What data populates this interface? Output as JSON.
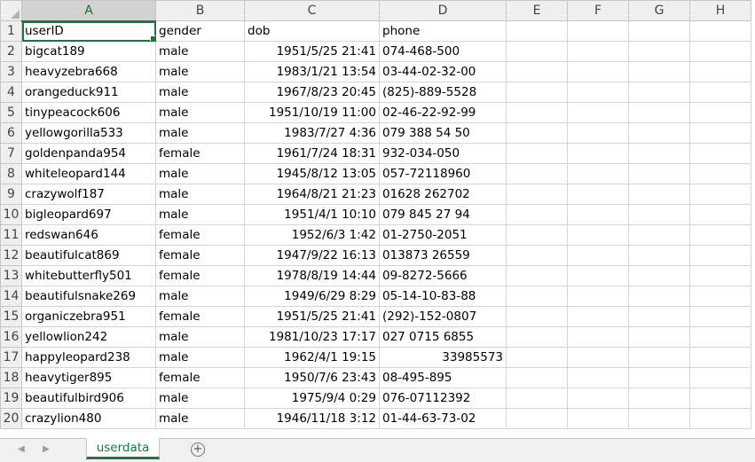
{
  "columns": [
    "A",
    "B",
    "C",
    "D",
    "E",
    "F",
    "G",
    "H"
  ],
  "rows": [
    {
      "n": "1",
      "a": "userID",
      "b": "gender",
      "c": "dob",
      "d": "phone",
      "d_num": false
    },
    {
      "n": "2",
      "a": "bigcat189",
      "b": "male",
      "c": "1951/5/25 21:41",
      "d": "074-468-500",
      "d_num": false
    },
    {
      "n": "3",
      "a": "heavyzebra668",
      "b": "male",
      "c": "1983/1/21 13:54",
      "d": "03-44-02-32-00",
      "d_num": false
    },
    {
      "n": "4",
      "a": "orangeduck911",
      "b": "male",
      "c": "1967/8/23 20:45",
      "d": "(825)-889-5528",
      "d_num": false
    },
    {
      "n": "5",
      "a": "tinypeacock606",
      "b": "male",
      "c": "1951/10/19 11:00",
      "d": "02-46-22-92-99",
      "d_num": false
    },
    {
      "n": "6",
      "a": "yellowgorilla533",
      "b": "male",
      "c": "1983/7/27 4:36",
      "d": "079 388 54 50",
      "d_num": false
    },
    {
      "n": "7",
      "a": "goldenpanda954",
      "b": "female",
      "c": "1961/7/24 18:31",
      "d": "932-034-050",
      "d_num": false
    },
    {
      "n": "8",
      "a": "whiteleopard144",
      "b": "male",
      "c": "1945/8/12 13:05",
      "d": "057-72118960",
      "d_num": false
    },
    {
      "n": "9",
      "a": "crazywolf187",
      "b": "male",
      "c": "1964/8/21 21:23",
      "d": "01628 262702",
      "d_num": false
    },
    {
      "n": "10",
      "a": "bigleopard697",
      "b": "male",
      "c": "1951/4/1 10:10",
      "d": "079 845 27 94",
      "d_num": false
    },
    {
      "n": "11",
      "a": "redswan646",
      "b": "female",
      "c": "1952/6/3 1:42",
      "d": "01-2750-2051",
      "d_num": false
    },
    {
      "n": "12",
      "a": "beautifulcat869",
      "b": "female",
      "c": "1947/9/22 16:13",
      "d": "013873 26559",
      "d_num": false
    },
    {
      "n": "13",
      "a": "whitebutterfly501",
      "b": "female",
      "c": "1978/8/19 14:44",
      "d": "09-8272-5666",
      "d_num": false
    },
    {
      "n": "14",
      "a": "beautifulsnake269",
      "b": "male",
      "c": "1949/6/29 8:29",
      "d": "05-14-10-83-88",
      "d_num": false
    },
    {
      "n": "15",
      "a": "organiczebra951",
      "b": "female",
      "c": "1951/5/25 21:41",
      "d": "(292)-152-0807",
      "d_num": false
    },
    {
      "n": "16",
      "a": "yellowlion242",
      "b": "male",
      "c": "1981/10/23 17:17",
      "d": "027 0715 6855",
      "d_num": false
    },
    {
      "n": "17",
      "a": "happyleopard238",
      "b": "male",
      "c": "1962/4/1 19:15",
      "d": "33985573",
      "d_num": true
    },
    {
      "n": "18",
      "a": "heavytiger895",
      "b": "female",
      "c": "1950/7/6 23:43",
      "d": "08-495-895",
      "d_num": false
    },
    {
      "n": "19",
      "a": "beautifulbird906",
      "b": "male",
      "c": "1975/9/4 0:29",
      "d": "076-07112392",
      "d_num": false
    },
    {
      "n": "20",
      "a": "crazylion480",
      "b": "male",
      "c": "1946/11/18 3:12",
      "d": "01-44-63-73-02",
      "d_num": false
    }
  ],
  "sheet_tab": "userdata",
  "add_sheet_symbol": "+",
  "nav_prev_symbol": "◀",
  "nav_next_symbol": "▶",
  "accent_color": "#217346"
}
